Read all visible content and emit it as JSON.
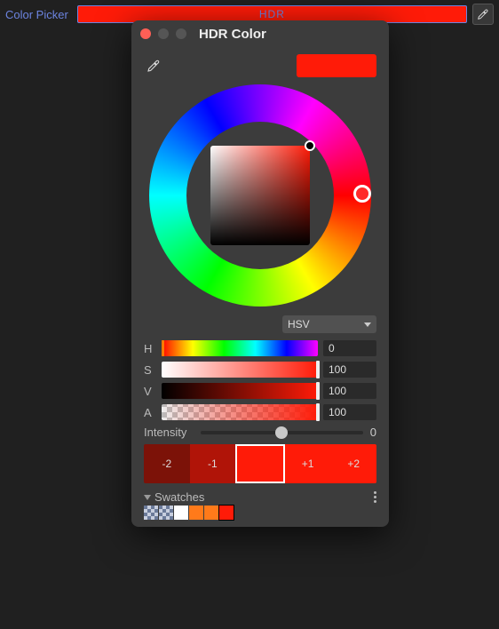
{
  "topbar": {
    "label": "Color Picker",
    "swatch_text": "HDR"
  },
  "dialog": {
    "title": "HDR Color",
    "current_color": "#ff1b08",
    "mode": "HSV",
    "channels": {
      "h": {
        "label": "H",
        "value": "0"
      },
      "s": {
        "label": "S",
        "value": "100"
      },
      "v": {
        "label": "V",
        "value": "100"
      },
      "a": {
        "label": "A",
        "value": "100"
      }
    },
    "intensity": {
      "label": "Intensity",
      "value": "0"
    },
    "stops": {
      "values": [
        "-2",
        "-1",
        "",
        "+1",
        "+2"
      ],
      "colors": [
        "#7c1208",
        "#b01408",
        "#ff1b08",
        "#ff1b08",
        "#ff1b08"
      ],
      "current": 2
    },
    "swatches": {
      "label": "Swatches",
      "items": [
        "checker",
        "checker",
        "#ffffff",
        "#ff7a1a",
        "#ff7a1a",
        "#ff1b08"
      ]
    }
  }
}
